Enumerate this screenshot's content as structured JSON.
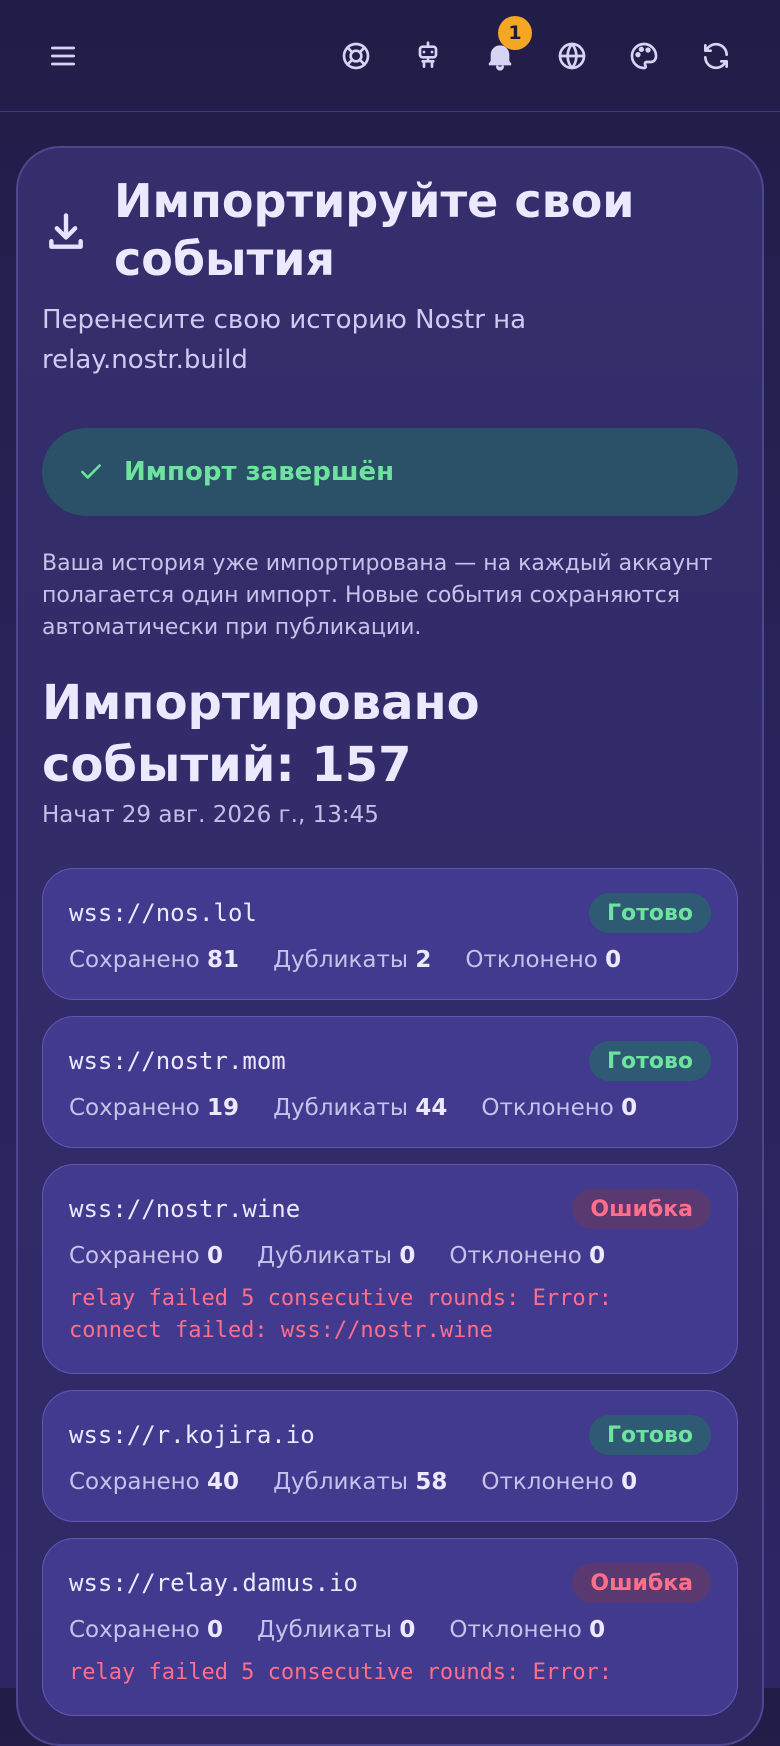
{
  "header": {
    "notification_count": "1",
    "icons": [
      "menu-icon",
      "lifebuoy-icon",
      "robot-icon",
      "bell-icon",
      "globe-icon",
      "palette-icon",
      "refresh-icon"
    ]
  },
  "import": {
    "title": "Импортируйте свои события",
    "subtitle": "Перенесите свою историю Nostr на relay.nostr.build",
    "status": "Импорт завершён",
    "info": "Ваша история уже импортирована — на каждый аккаунт полагается один импорт. Новые события сохраняются автоматически при публикации.",
    "count_title": "Импортировано событий: 157",
    "started": "Начат 29 авг. 2026 г., 13:45"
  },
  "labels": {
    "saved": "Сохранено",
    "duplicates": "Дубликаты",
    "rejected": "Отклонено"
  },
  "relays": [
    {
      "url": "wss://nos.lol",
      "status": "Готово",
      "state": "ok",
      "saved": "81",
      "duplicates": "2",
      "rejected": "0",
      "error": ""
    },
    {
      "url": "wss://nostr.mom",
      "status": "Готово",
      "state": "ok",
      "saved": "19",
      "duplicates": "44",
      "rejected": "0",
      "error": ""
    },
    {
      "url": "wss://nostr.wine",
      "status": "Ошибка",
      "state": "err",
      "saved": "0",
      "duplicates": "0",
      "rejected": "0",
      "error": "relay failed 5 consecutive rounds: Error: connect failed: wss://nostr.wine"
    },
    {
      "url": "wss://r.kojira.io",
      "status": "Готово",
      "state": "ok",
      "saved": "40",
      "duplicates": "58",
      "rejected": "0",
      "error": ""
    },
    {
      "url": "wss://relay.damus.io",
      "status": "Ошибка",
      "state": "err",
      "saved": "0",
      "duplicates": "0",
      "rejected": "0",
      "error": "relay failed 5 consecutive rounds: Error:"
    }
  ],
  "colors": {
    "background": "#241f4e",
    "accent_success": "#6ee3a0",
    "accent_error": "#ff6e8a",
    "badge": "#f5a623"
  }
}
